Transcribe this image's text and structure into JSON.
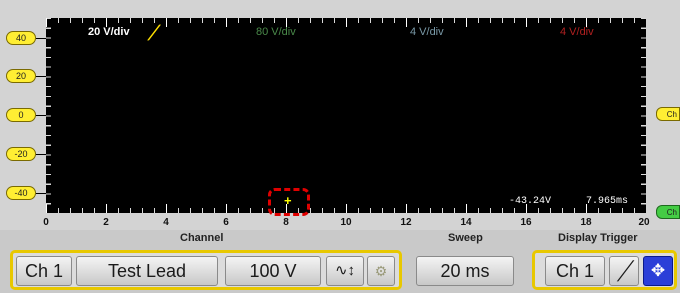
{
  "screen": {
    "channels": [
      {
        "label": "20 V/div",
        "color": "#ffffff"
      },
      {
        "label": "80 V/div",
        "color": "#4a8a4a"
      },
      {
        "label": "4 V/div",
        "color": "#7a9aa8"
      },
      {
        "label": "4 V/div",
        "color": "#b02020"
      }
    ],
    "trigger_slope_glyph": "╱",
    "readout": {
      "voltage": "-43.24V",
      "time": "7.965ms"
    },
    "cursor_marker": "+"
  },
  "y_axis": {
    "labels": [
      "40",
      "20",
      "0",
      "-20",
      "-40"
    ],
    "accent": "#ffee33"
  },
  "side_tags": [
    {
      "label": "Ch",
      "color": "#ffee33"
    },
    {
      "label": "Ch",
      "color": "#44cc44"
    }
  ],
  "x_axis": {
    "labels": [
      "0",
      "2",
      "4",
      "6",
      "8",
      "10",
      "12",
      "14",
      "16",
      "18",
      "20"
    ]
  },
  "sections": {
    "channel": "Channel",
    "sweep": "Sweep",
    "trigger": "Display Trigger"
  },
  "channel_panel": {
    "channel_button": "Ch 1",
    "lead_button": "Test Lead",
    "volts_button": "100 V",
    "coupling_icon": "coupling-icon",
    "coupling_glyph": "∿↕",
    "probe_icon": "probe-icon",
    "probe_glyph": "⚙"
  },
  "sweep_panel": {
    "sweep_button": "20 ms"
  },
  "trigger_panel": {
    "channel_button": "Ch 1",
    "slope_glyph": "╱",
    "move_icon": "move-arrows-icon",
    "move_glyph": "✥"
  },
  "colors": {
    "panel_border": "#e8c800",
    "move_button": "#2b3fd8",
    "cursor_box": "#e00000"
  }
}
